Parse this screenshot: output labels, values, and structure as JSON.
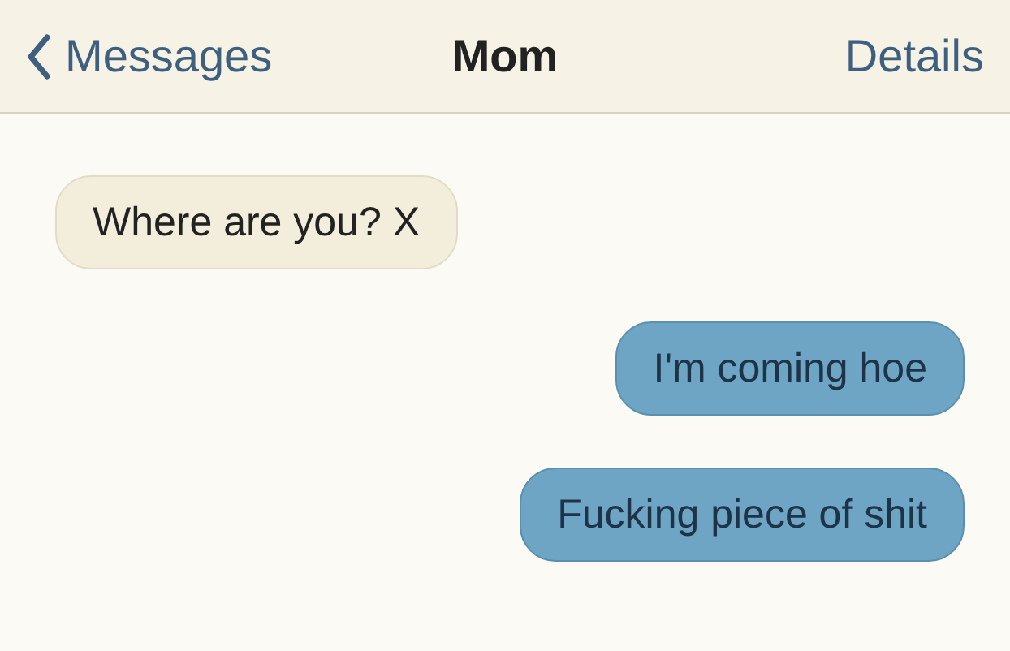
{
  "header": {
    "back_label": "Messages",
    "title": "Mom",
    "action": "Details"
  },
  "messages": [
    {
      "kind": "received",
      "text": "Where are you? X"
    },
    {
      "kind": "sent",
      "text": "I'm coming hoe"
    },
    {
      "kind": "sent",
      "text": "Fucking piece of shit"
    }
  ]
}
